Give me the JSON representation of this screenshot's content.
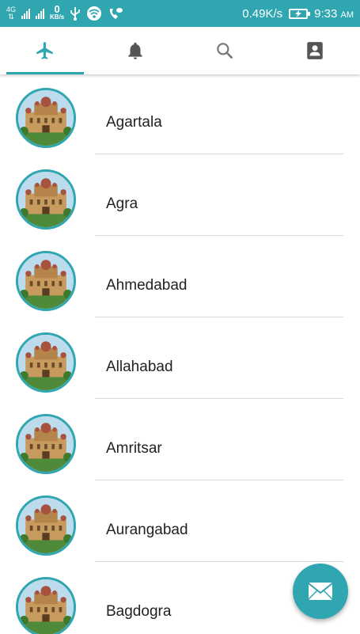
{
  "status_bar": {
    "network_type": "4G",
    "data_rate_value": "0",
    "data_rate_unit": "KB/s",
    "speed": "0.49K/s",
    "time": "9:33",
    "ampm": "AM"
  },
  "tabs": [
    {
      "icon": "airplane-icon",
      "active": true
    },
    {
      "icon": "bell-icon",
      "active": false
    },
    {
      "icon": "search-icon",
      "active": false
    },
    {
      "icon": "contact-icon",
      "active": false
    }
  ],
  "cities": [
    {
      "name": "Agartala"
    },
    {
      "name": "Agra"
    },
    {
      "name": "Ahmedabad"
    },
    {
      "name": "Allahabad"
    },
    {
      "name": "Amritsar"
    },
    {
      "name": "Aurangabad"
    },
    {
      "name": "Bagdogra"
    }
  ],
  "fab": {
    "icon": "mail-icon"
  },
  "colors": {
    "accent": "#2fa6b0",
    "text": "#222222",
    "divider": "#d9d9d9",
    "inactive_icon": "#555555"
  }
}
